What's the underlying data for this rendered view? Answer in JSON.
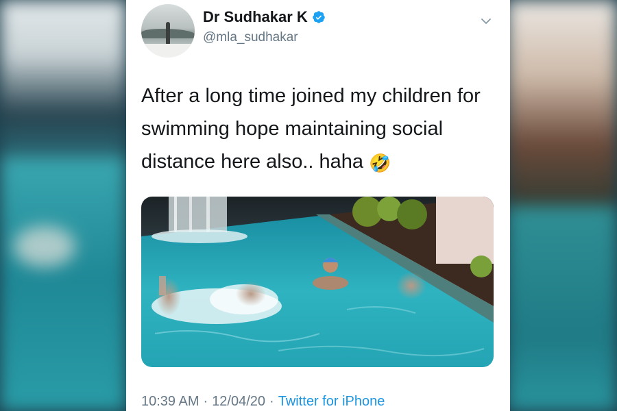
{
  "tweet": {
    "author": {
      "display_name": "Dr Sudhakar K",
      "handle": "@mla_sudhakar",
      "verified": true,
      "avatar_icon": "profile-photo-icon"
    },
    "text": "After a long time joined my children for swimming hope maintaining social distance here also.. haha",
    "emoji": "🤣",
    "media": {
      "icon": "swimming-pool-photo"
    },
    "meta": {
      "time": "10:39 AM",
      "separator": "·",
      "date": "12/04/20",
      "source": "Twitter for iPhone"
    }
  },
  "colors": {
    "text_primary": "#14171a",
    "text_secondary": "#657786",
    "link": "#1b95e0",
    "verified_badge": "#1da1f2",
    "pool_water": "#2fb3c0"
  }
}
